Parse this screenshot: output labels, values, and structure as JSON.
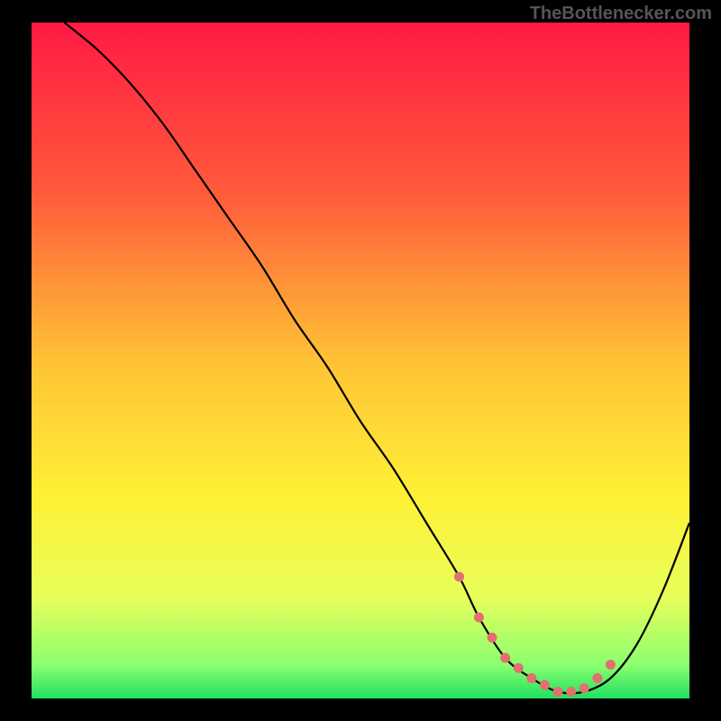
{
  "watermark": "TheBottlenecker.com",
  "chart_data": {
    "type": "line",
    "title": "",
    "xlabel": "",
    "ylabel": "",
    "xlim": [
      0,
      100
    ],
    "ylim": [
      0,
      100
    ],
    "grid": false,
    "background_gradient": {
      "stops": [
        {
          "offset": 0,
          "color": "#ff1a44"
        },
        {
          "offset": 25,
          "color": "#ff5a3a"
        },
        {
          "offset": 50,
          "color": "#ffc236"
        },
        {
          "offset": 70,
          "color": "#fff035"
        },
        {
          "offset": 85,
          "color": "#e8ff5a"
        },
        {
          "offset": 95,
          "color": "#8cff70"
        },
        {
          "offset": 100,
          "color": "#20e060"
        }
      ]
    },
    "series": [
      {
        "name": "bottleneck-curve",
        "x": [
          5,
          10,
          15,
          20,
          25,
          30,
          35,
          40,
          45,
          50,
          55,
          60,
          65,
          68,
          72,
          76,
          80,
          84,
          88,
          92,
          96,
          100
        ],
        "y": [
          100,
          96,
          91,
          85,
          78,
          71,
          64,
          56,
          49,
          41,
          34,
          26,
          18,
          12,
          6,
          3,
          1,
          1,
          3,
          8,
          16,
          26
        ]
      }
    ],
    "markers": {
      "name": "optimal-range-dots",
      "color": "#e27070",
      "x": [
        65,
        68,
        70,
        72,
        74,
        76,
        78,
        80,
        82,
        84,
        86,
        88
      ],
      "y": [
        18,
        12,
        9,
        6,
        4.5,
        3,
        2,
        1,
        1,
        1.5,
        3,
        5
      ]
    }
  }
}
